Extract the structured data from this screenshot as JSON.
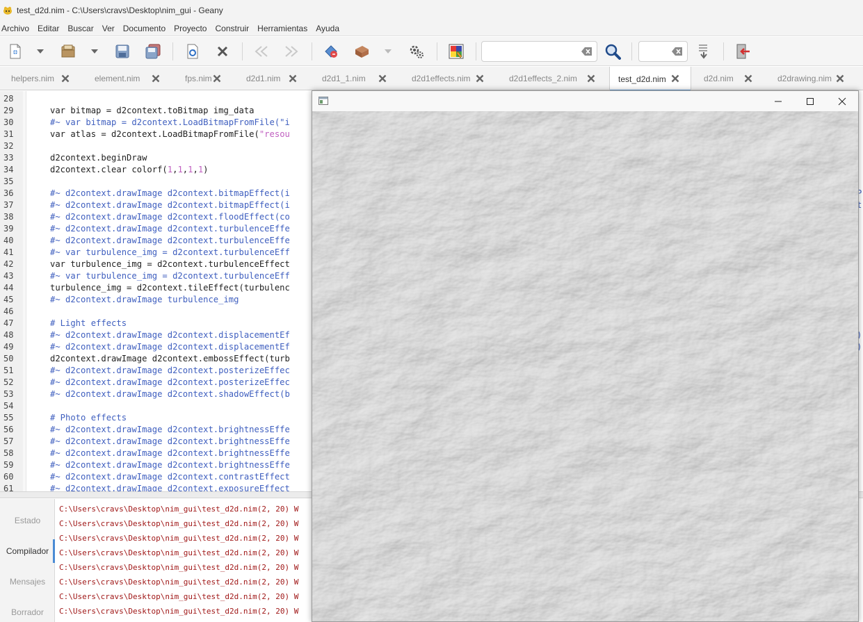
{
  "window": {
    "title": "test_d2d.nim - C:\\Users\\cravs\\Desktop\\nim_gui - Geany"
  },
  "menu": [
    "Archivo",
    "Editar",
    "Buscar",
    "Ver",
    "Documento",
    "Proyecto",
    "Construir",
    "Herramientas",
    "Ayuda"
  ],
  "toolbar": {
    "search_value": "",
    "goto_value": "",
    "icons": [
      "new-file-icon",
      "open-file-icon",
      "save-icon",
      "save-all-icon",
      "reload-icon",
      "close-icon",
      "navigate-back-icon",
      "navigate-forward-icon",
      "compile-icon",
      "build-icon",
      "execute-icon",
      "color-picker-icon",
      "find-icon",
      "goto-line-icon",
      "quit-icon"
    ]
  },
  "tabs": [
    {
      "label": "helpers.nim",
      "active": false
    },
    {
      "label": "element.nim",
      "active": false
    },
    {
      "label": "fps.nim",
      "active": false
    },
    {
      "label": "d2d1.nim",
      "active": false
    },
    {
      "label": "d2d1_1.nim",
      "active": false
    },
    {
      "label": "d2d1effects.nim",
      "active": false
    },
    {
      "label": "d2d1effects_2.nim",
      "active": false
    },
    {
      "label": "test_d2d.nim",
      "active": true
    },
    {
      "label": "d2d.nim",
      "active": false
    },
    {
      "label": "d2drawing.nim",
      "active": false
    }
  ],
  "editor": {
    "line_numbers": [
      "28",
      "29",
      "30",
      "31",
      "32",
      "33",
      "34",
      "35",
      "36",
      "37",
      "38",
      "39",
      "40",
      "41",
      "42",
      "43",
      "44",
      "45",
      "46",
      "47",
      "48",
      "49",
      "50",
      "51",
      "52",
      "53",
      "54",
      "55",
      "56",
      "57",
      "58",
      "59",
      "60",
      "61"
    ],
    "lines": [
      "",
      "var bitmap = d2context.toBitmap img_data",
      "#~ var bitmap = d2context.LoadBitmapFromFile(\"i",
      "var atlas = d2context.LoadBitmapFromFile(\"resou",
      "",
      "d2context.beginDraw",
      "d2context.clear colorf(1,1,1,1)",
      "",
      "#~ d2context.drawImage d2context.bitmapEffect(i",
      "#~ d2context.drawImage d2context.bitmapEffect(i",
      "#~ d2context.drawImage d2context.floodEffect(co",
      "#~ d2context.drawImage d2context.turbulenceEffe",
      "#~ d2context.drawImage d2context.turbulenceEffe",
      "#~ var turbulence_img = d2context.turbulenceEff",
      "var turbulence_img = d2context.turbulenceEffect",
      "#~ var turbulence_img = d2context.turbulenceEff",
      "turbulence_img = d2context.tileEffect(turbulenc",
      "#~ d2context.drawImage turbulence_img",
      "",
      "# Light effects",
      "#~ d2context.drawImage d2context.displacementEf",
      "#~ d2context.drawImage d2context.displacementEf",
      "d2context.drawImage d2context.embossEffect(turb",
      "#~ d2context.drawImage d2context.posterizeEffec",
      "#~ d2context.drawImage d2context.posterizeEffec",
      "#~ d2context.drawImage d2context.shadowEffect(b",
      "",
      "# Photo effects",
      "#~ d2context.drawImage d2context.brightnessEffe",
      "#~ d2context.drawImage d2context.brightnessEffe",
      "#~ d2context.drawImage d2context.brightnessEffe",
      "#~ d2context.drawImage d2context.brightnessEffe",
      "#~ d2context.drawImage d2context.contrastEffect",
      "#~ d2context.drawImage d2context.exposureEffect"
    ],
    "right_fragments": [
      {
        "line_index": 8,
        "text": "P"
      },
      {
        "line_index": 9,
        "text": "t"
      },
      {
        "line_index": 20,
        "text": ")"
      },
      {
        "line_index": 21,
        "text": ")"
      }
    ]
  },
  "messages": {
    "tabs": [
      {
        "label": "Estado",
        "active": false
      },
      {
        "label": "Compilador",
        "active": true
      },
      {
        "label": "Mensajes",
        "active": false
      },
      {
        "label": "Borrador",
        "active": false
      }
    ],
    "lines": [
      "C:\\Users\\cravs\\Desktop\\nim_gui\\test_d2d.nim(2, 20) W",
      "C:\\Users\\cravs\\Desktop\\nim_gui\\test_d2d.nim(2, 20) W",
      "C:\\Users\\cravs\\Desktop\\nim_gui\\test_d2d.nim(2, 20) W",
      "C:\\Users\\cravs\\Desktop\\nim_gui\\test_d2d.nim(2, 20) W",
      "C:\\Users\\cravs\\Desktop\\nim_gui\\test_d2d.nim(2, 20) W",
      "C:\\Users\\cravs\\Desktop\\nim_gui\\test_d2d.nim(2, 20) W",
      "C:\\Users\\cravs\\Desktop\\nim_gui\\test_d2d.nim(2, 20) W",
      "C:\\Users\\cravs\\Desktop\\nim_gui\\test_d2d.nim(2, 20) W"
    ]
  },
  "floating_window": {
    "title": ""
  },
  "colors": {
    "comment": "#3f5fbf",
    "string": "#c05fc0",
    "message": "#a01818",
    "accent": "#4a8bd4"
  }
}
